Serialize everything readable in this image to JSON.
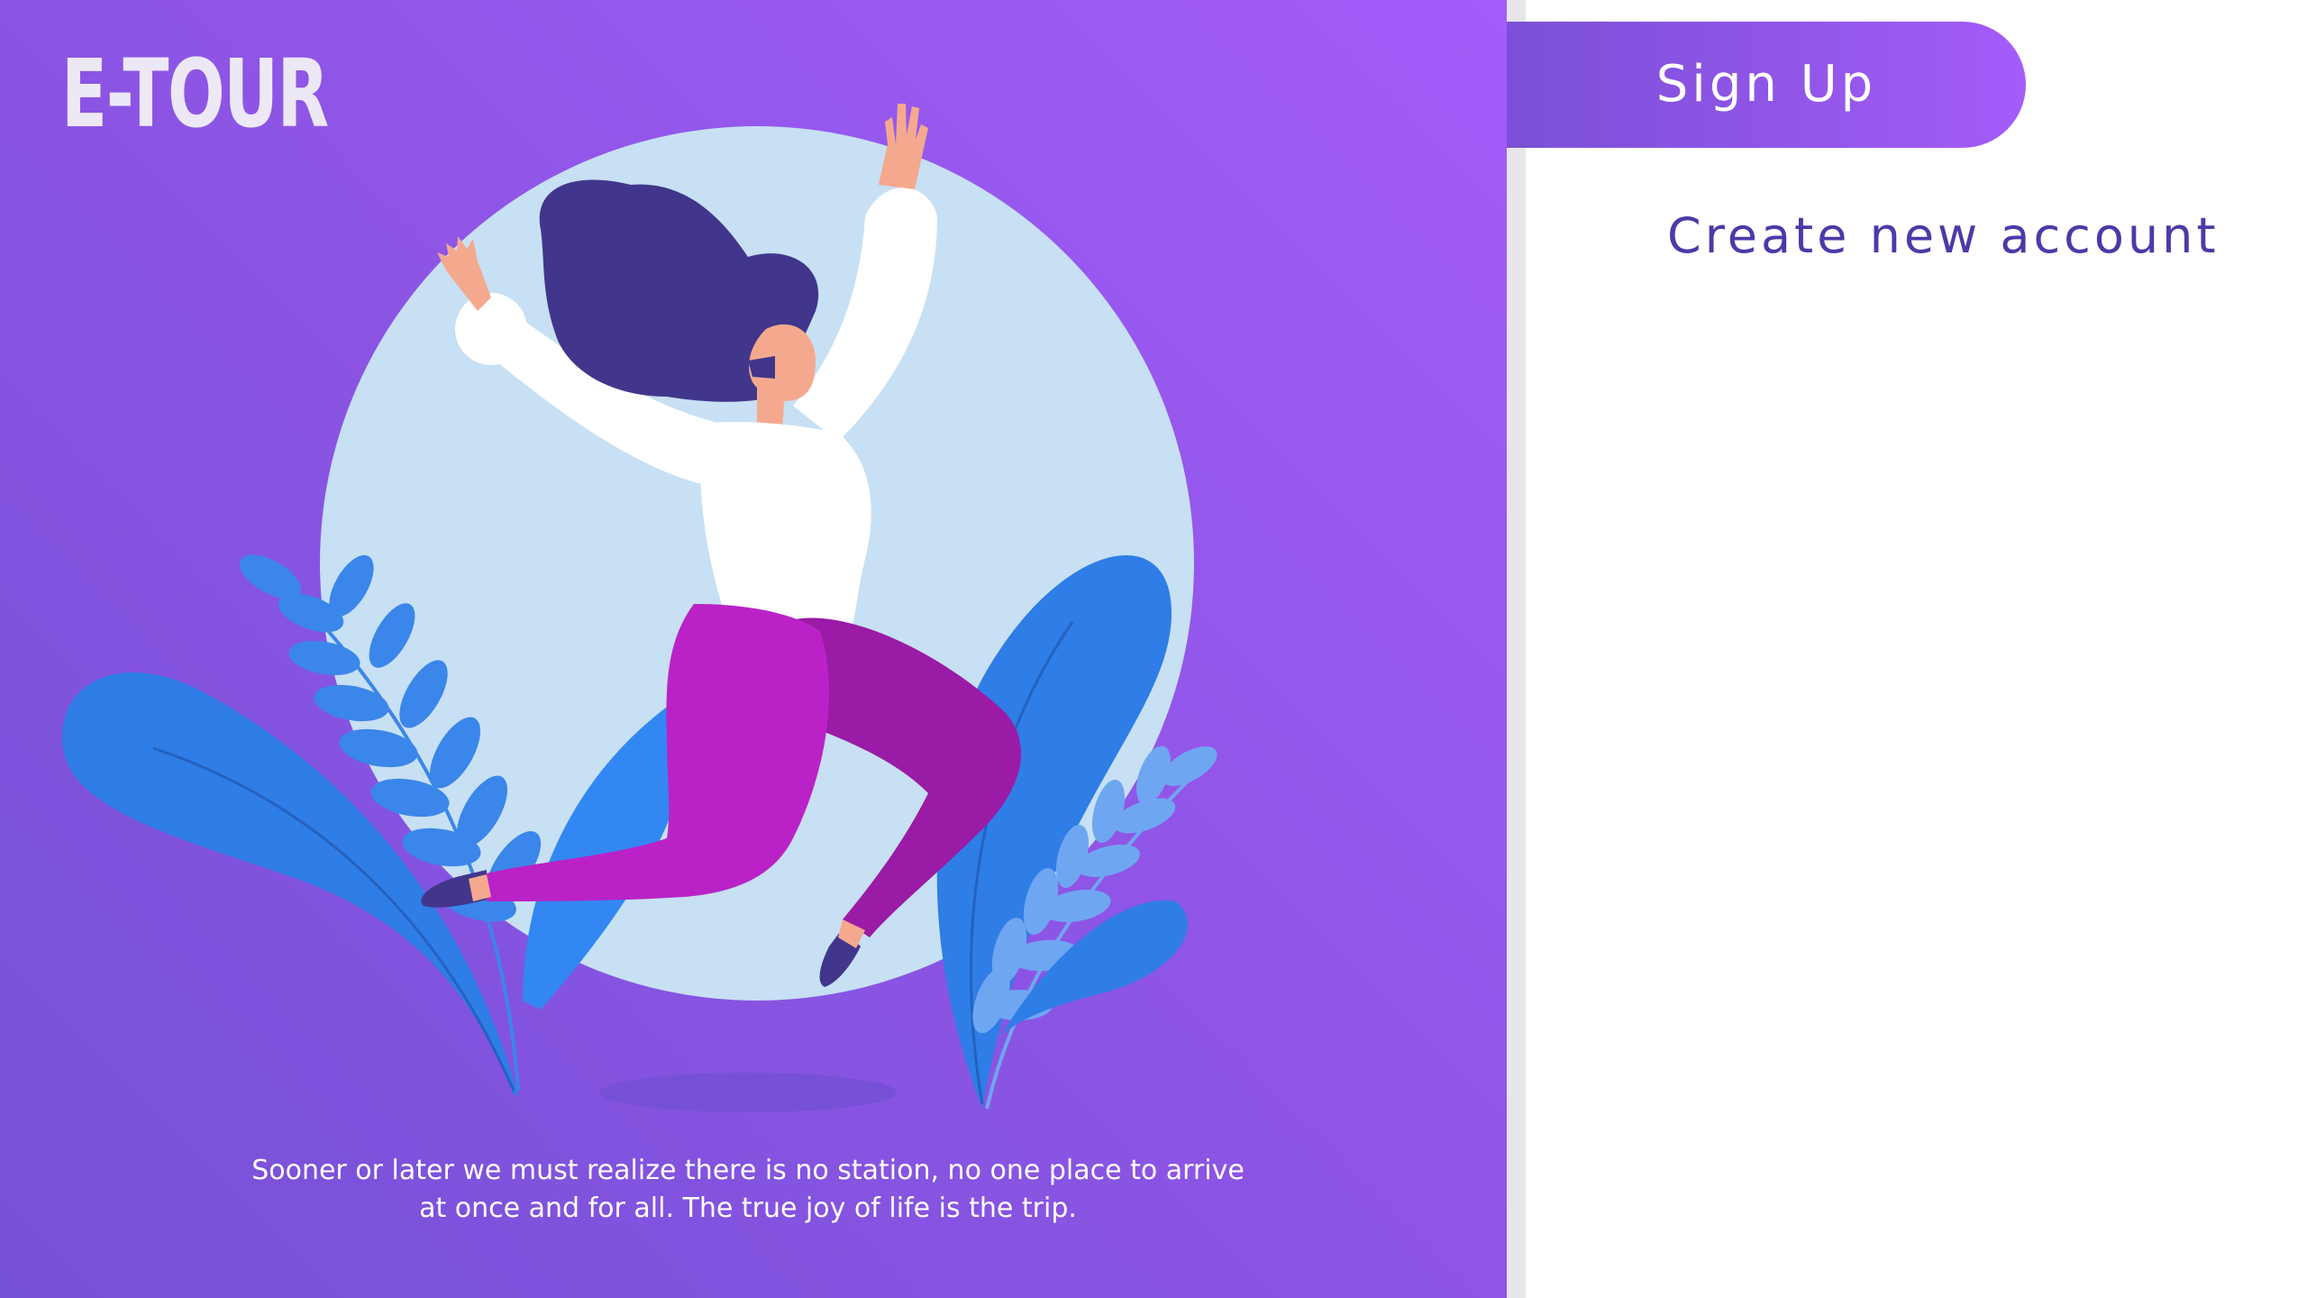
{
  "brand": {
    "logo_text": "E-TOUR"
  },
  "hero": {
    "quote_line1": "Sooner or later we must realize there is no station, no one place to arrive",
    "quote_line2": "at once and for all. The true joy of life is the trip."
  },
  "auth": {
    "tab_label": "Sign Up",
    "subtitle": "Create new account"
  },
  "colors": {
    "hero_gradient_start": "#a45cfa",
    "hero_gradient_end": "#7551d6",
    "accent": "#4b3aa8",
    "background": "#ffffff"
  },
  "icons": {
    "illustration": "woman-jumping-illustration"
  }
}
